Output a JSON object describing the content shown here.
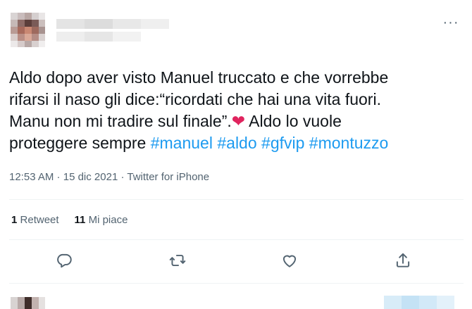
{
  "tweet": {
    "text_segments": [
      {
        "type": "text",
        "value": "Aldo dopo aver visto Manuel truccato e che vorrebbe\nrifarsi il naso gli dice:“ricordati che hai una vita fuori.\nManu non mi tradire sul finale”."
      },
      {
        "type": "emoji",
        "value": "❤"
      },
      {
        "type": "text",
        "value": " Aldo lo vuole\nproteggere sempre "
      },
      {
        "type": "hashtag",
        "value": "#manuel"
      },
      {
        "type": "text",
        "value": " "
      },
      {
        "type": "hashtag",
        "value": "#aldo"
      },
      {
        "type": "text",
        "value": " "
      },
      {
        "type": "hashtag",
        "value": "#gfvip"
      },
      {
        "type": "text",
        "value": " "
      },
      {
        "type": "hashtag",
        "value": "#montuzzo"
      }
    ],
    "time": "12:53 AM",
    "separator": " · ",
    "date": "15 dic 2021",
    "source": "Twitter for iPhone",
    "more_label": "···"
  },
  "stats": {
    "retweets_count": "1",
    "retweets_label": "Retweet",
    "likes_count": "11",
    "likes_label": "Mi piace"
  },
  "actions": [
    "reply-icon",
    "retweet-icon",
    "like-icon",
    "share-icon"
  ],
  "colors": {
    "text": "#0f1419",
    "secondary": "#536471",
    "hashtag": "#1d9bf0",
    "heart": "#e0245e",
    "divider": "#eff3f4"
  }
}
